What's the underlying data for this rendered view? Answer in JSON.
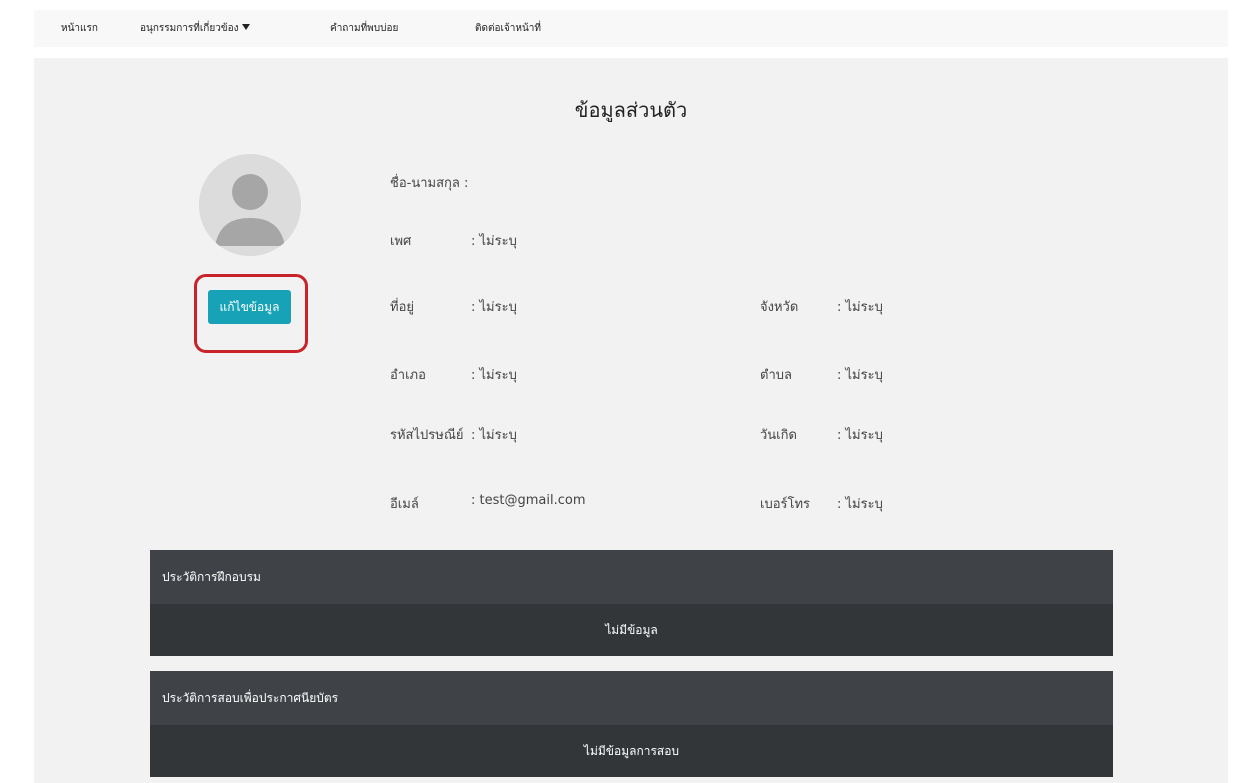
{
  "nav": {
    "home": "หน้าแรก",
    "subcommittees": "อนุกรรมการที่เกี่ยวข้อง",
    "faq": "คำถามที่พบบ่อย",
    "contact": "ติดต่อเจ้าหน้าที่"
  },
  "profile": {
    "title": "ข้อมูลส่วนตัว",
    "edit_button": "แก้ไขข้อมูล",
    "name_label": "ชื่อ-นามสกุล :",
    "fields": {
      "gender_label": "เพศ",
      "gender_value": ": ไม่ระบุ",
      "address_label": "ที่อยู่",
      "address_value": ": ไม่ระบุ",
      "province_label": "จังหวัด",
      "province_value": ": ไม่ระบุ",
      "district_label": "อำเภอ",
      "district_value": ": ไม่ระบุ",
      "subdistrict_label": "ตำบล",
      "subdistrict_value": ": ไม่ระบุ",
      "postcode_label": "รหัสไปรษณีย์",
      "postcode_value": ": ไม่ระบุ",
      "birthdate_label": "วันเกิด",
      "birthdate_value": ": ไม่ระบุ",
      "email_label": "อีเมล์",
      "email_value": ": test@gmail.com",
      "phone_label": "เบอร์โทร",
      "phone_value": ": ไม่ระบุ"
    }
  },
  "training": {
    "heading": "ประวัติการฝึกอบรม",
    "empty": "ไม่มีข้อมูล"
  },
  "exam": {
    "heading": "ประวัติการสอบเพื่อประกาศนียบัตร",
    "empty": "ไม่มีข้อมูลการสอบ"
  },
  "colors": {
    "button": "#17a2b8",
    "highlight": "#c8222a",
    "panel_header": "#3f4347",
    "panel_body": "#333639"
  }
}
